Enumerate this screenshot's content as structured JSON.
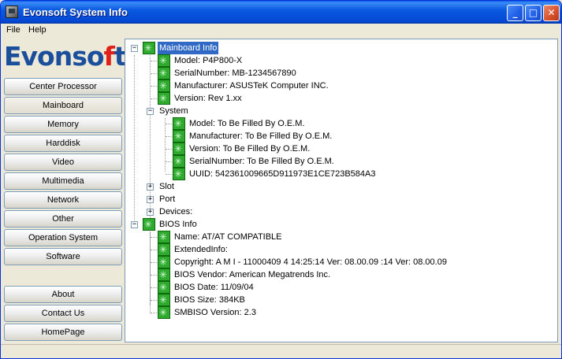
{
  "window": {
    "title": "Evonsoft System Info"
  },
  "menu": [
    {
      "label": "File"
    },
    {
      "label": "Help"
    }
  ],
  "logo": {
    "part1": "Evonso",
    "part2": "f",
    "part3": "t"
  },
  "nav": {
    "center_processor": "Center Processor",
    "mainboard": "Mainboard",
    "memory": "Memory",
    "harddisk": "Harddisk",
    "video": "Video",
    "multimedia": "Multimedia",
    "network": "Network",
    "other": "Other",
    "operation_system": "Operation System",
    "software": "Software",
    "about": "About",
    "contact_us": "Contact Us",
    "homepage": "HomePage"
  },
  "tree": {
    "mainboard_info": "Mainboard Info",
    "model": "Model: P4P800-X",
    "serial": "SerialNumber: MB-1234567890",
    "manufacturer": "Manufacturer: ASUSTeK Computer INC.",
    "version": "Version: Rev 1.xx",
    "system": "System",
    "sys_model": "Model: To Be Filled By O.E.M.",
    "sys_manufacturer": "Manufacturer: To Be Filled By O.E.M.",
    "sys_version": "Version: To Be Filled By O.E.M.",
    "sys_serial": "SerialNumber: To Be Filled By O.E.M.",
    "sys_uuid": "UUID: 542361009665D911973E1CE723B584A3",
    "slot": "Slot",
    "port": "Port",
    "devices": "Devices:",
    "bios_info": "BIOS Info",
    "bios_name": "Name: AT/AT COMPATIBLE",
    "bios_extended": "ExtendedInfo:",
    "bios_copyright": "Copyright: A M I  - 11000409 4 14:25:14 Ver: 08.00.09 :14 Ver: 08.00.09",
    "bios_vendor": "BIOS Vendor: American Megatrends Inc.",
    "bios_date": "BIOS Date: 11/09/04",
    "bios_size": "BIOS Size: 384KB",
    "smbios": "SMBISO Version: 2.3"
  },
  "colors": {
    "titlebar": "#0a5ae0",
    "selection": "#316ac5",
    "logo_blue": "#1b4f9c",
    "logo_red": "#e0201b",
    "tree_icon": "#2faa2f"
  }
}
